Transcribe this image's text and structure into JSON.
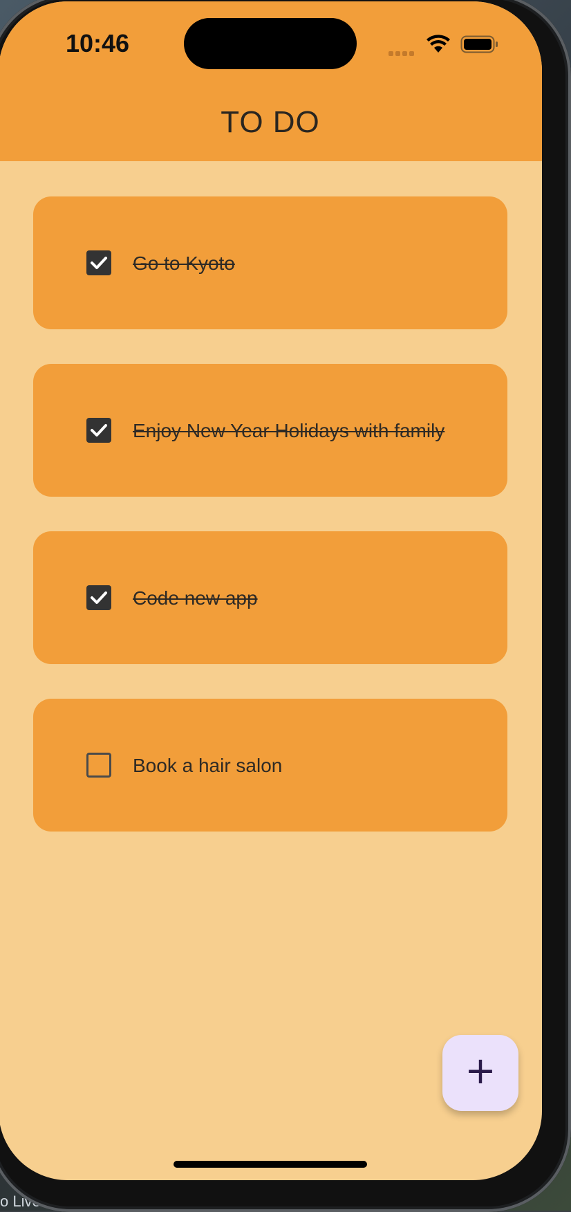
{
  "status_bar": {
    "time": "10:46",
    "icons": [
      "cellular-signal-icon",
      "wifi-icon",
      "battery-icon"
    ]
  },
  "app_bar": {
    "title": "TO DO",
    "background": "#f29e3a"
  },
  "todos": [
    {
      "label": "Go to Kyoto",
      "completed": true
    },
    {
      "label": "Enjoy New Year Holidays with family",
      "completed": true
    },
    {
      "label": "Code new app",
      "completed": true
    },
    {
      "label": "Book a hair salon",
      "completed": false
    }
  ],
  "fab": {
    "icon": "plus-icon",
    "symbol": "+",
    "background": "#ebe1fb"
  },
  "colors": {
    "screen_background": "#f7cf8f",
    "card_background": "#f29e3a",
    "checkbox_checked": "#333333"
  },
  "desktop": {
    "caption": "o Live"
  }
}
